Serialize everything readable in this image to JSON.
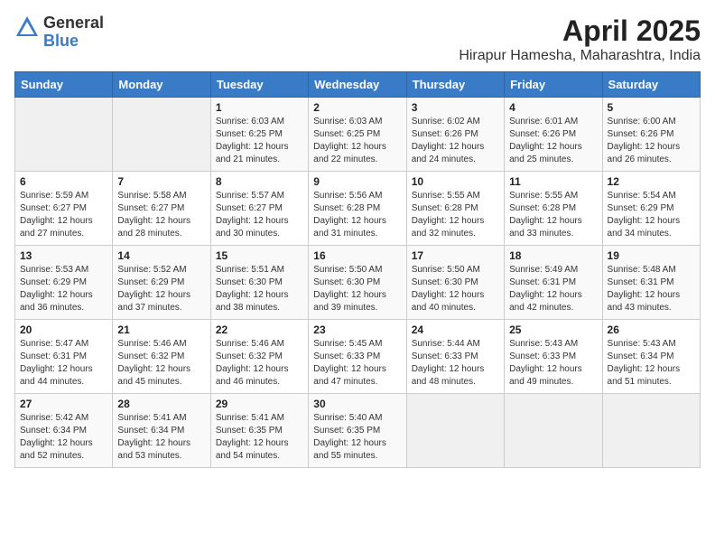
{
  "header": {
    "logo_general": "General",
    "logo_blue": "Blue",
    "month_title": "April 2025",
    "location": "Hirapur Hamesha, Maharashtra, India"
  },
  "days_of_week": [
    "Sunday",
    "Monday",
    "Tuesday",
    "Wednesday",
    "Thursday",
    "Friday",
    "Saturday"
  ],
  "weeks": [
    [
      {
        "day": "",
        "empty": true
      },
      {
        "day": "",
        "empty": true
      },
      {
        "day": "1",
        "sunrise": "Sunrise: 6:03 AM",
        "sunset": "Sunset: 6:25 PM",
        "daylight": "Daylight: 12 hours and 21 minutes."
      },
      {
        "day": "2",
        "sunrise": "Sunrise: 6:03 AM",
        "sunset": "Sunset: 6:25 PM",
        "daylight": "Daylight: 12 hours and 22 minutes."
      },
      {
        "day": "3",
        "sunrise": "Sunrise: 6:02 AM",
        "sunset": "Sunset: 6:26 PM",
        "daylight": "Daylight: 12 hours and 24 minutes."
      },
      {
        "day": "4",
        "sunrise": "Sunrise: 6:01 AM",
        "sunset": "Sunset: 6:26 PM",
        "daylight": "Daylight: 12 hours and 25 minutes."
      },
      {
        "day": "5",
        "sunrise": "Sunrise: 6:00 AM",
        "sunset": "Sunset: 6:26 PM",
        "daylight": "Daylight: 12 hours and 26 minutes."
      }
    ],
    [
      {
        "day": "6",
        "sunrise": "Sunrise: 5:59 AM",
        "sunset": "Sunset: 6:27 PM",
        "daylight": "Daylight: 12 hours and 27 minutes."
      },
      {
        "day": "7",
        "sunrise": "Sunrise: 5:58 AM",
        "sunset": "Sunset: 6:27 PM",
        "daylight": "Daylight: 12 hours and 28 minutes."
      },
      {
        "day": "8",
        "sunrise": "Sunrise: 5:57 AM",
        "sunset": "Sunset: 6:27 PM",
        "daylight": "Daylight: 12 hours and 30 minutes."
      },
      {
        "day": "9",
        "sunrise": "Sunrise: 5:56 AM",
        "sunset": "Sunset: 6:28 PM",
        "daylight": "Daylight: 12 hours and 31 minutes."
      },
      {
        "day": "10",
        "sunrise": "Sunrise: 5:55 AM",
        "sunset": "Sunset: 6:28 PM",
        "daylight": "Daylight: 12 hours and 32 minutes."
      },
      {
        "day": "11",
        "sunrise": "Sunrise: 5:55 AM",
        "sunset": "Sunset: 6:28 PM",
        "daylight": "Daylight: 12 hours and 33 minutes."
      },
      {
        "day": "12",
        "sunrise": "Sunrise: 5:54 AM",
        "sunset": "Sunset: 6:29 PM",
        "daylight": "Daylight: 12 hours and 34 minutes."
      }
    ],
    [
      {
        "day": "13",
        "sunrise": "Sunrise: 5:53 AM",
        "sunset": "Sunset: 6:29 PM",
        "daylight": "Daylight: 12 hours and 36 minutes."
      },
      {
        "day": "14",
        "sunrise": "Sunrise: 5:52 AM",
        "sunset": "Sunset: 6:29 PM",
        "daylight": "Daylight: 12 hours and 37 minutes."
      },
      {
        "day": "15",
        "sunrise": "Sunrise: 5:51 AM",
        "sunset": "Sunset: 6:30 PM",
        "daylight": "Daylight: 12 hours and 38 minutes."
      },
      {
        "day": "16",
        "sunrise": "Sunrise: 5:50 AM",
        "sunset": "Sunset: 6:30 PM",
        "daylight": "Daylight: 12 hours and 39 minutes."
      },
      {
        "day": "17",
        "sunrise": "Sunrise: 5:50 AM",
        "sunset": "Sunset: 6:30 PM",
        "daylight": "Daylight: 12 hours and 40 minutes."
      },
      {
        "day": "18",
        "sunrise": "Sunrise: 5:49 AM",
        "sunset": "Sunset: 6:31 PM",
        "daylight": "Daylight: 12 hours and 42 minutes."
      },
      {
        "day": "19",
        "sunrise": "Sunrise: 5:48 AM",
        "sunset": "Sunset: 6:31 PM",
        "daylight": "Daylight: 12 hours and 43 minutes."
      }
    ],
    [
      {
        "day": "20",
        "sunrise": "Sunrise: 5:47 AM",
        "sunset": "Sunset: 6:31 PM",
        "daylight": "Daylight: 12 hours and 44 minutes."
      },
      {
        "day": "21",
        "sunrise": "Sunrise: 5:46 AM",
        "sunset": "Sunset: 6:32 PM",
        "daylight": "Daylight: 12 hours and 45 minutes."
      },
      {
        "day": "22",
        "sunrise": "Sunrise: 5:46 AM",
        "sunset": "Sunset: 6:32 PM",
        "daylight": "Daylight: 12 hours and 46 minutes."
      },
      {
        "day": "23",
        "sunrise": "Sunrise: 5:45 AM",
        "sunset": "Sunset: 6:33 PM",
        "daylight": "Daylight: 12 hours and 47 minutes."
      },
      {
        "day": "24",
        "sunrise": "Sunrise: 5:44 AM",
        "sunset": "Sunset: 6:33 PM",
        "daylight": "Daylight: 12 hours and 48 minutes."
      },
      {
        "day": "25",
        "sunrise": "Sunrise: 5:43 AM",
        "sunset": "Sunset: 6:33 PM",
        "daylight": "Daylight: 12 hours and 49 minutes."
      },
      {
        "day": "26",
        "sunrise": "Sunrise: 5:43 AM",
        "sunset": "Sunset: 6:34 PM",
        "daylight": "Daylight: 12 hours and 51 minutes."
      }
    ],
    [
      {
        "day": "27",
        "sunrise": "Sunrise: 5:42 AM",
        "sunset": "Sunset: 6:34 PM",
        "daylight": "Daylight: 12 hours and 52 minutes."
      },
      {
        "day": "28",
        "sunrise": "Sunrise: 5:41 AM",
        "sunset": "Sunset: 6:34 PM",
        "daylight": "Daylight: 12 hours and 53 minutes."
      },
      {
        "day": "29",
        "sunrise": "Sunrise: 5:41 AM",
        "sunset": "Sunset: 6:35 PM",
        "daylight": "Daylight: 12 hours and 54 minutes."
      },
      {
        "day": "30",
        "sunrise": "Sunrise: 5:40 AM",
        "sunset": "Sunset: 6:35 PM",
        "daylight": "Daylight: 12 hours and 55 minutes."
      },
      {
        "day": "",
        "empty": true
      },
      {
        "day": "",
        "empty": true
      },
      {
        "day": "",
        "empty": true
      }
    ]
  ]
}
